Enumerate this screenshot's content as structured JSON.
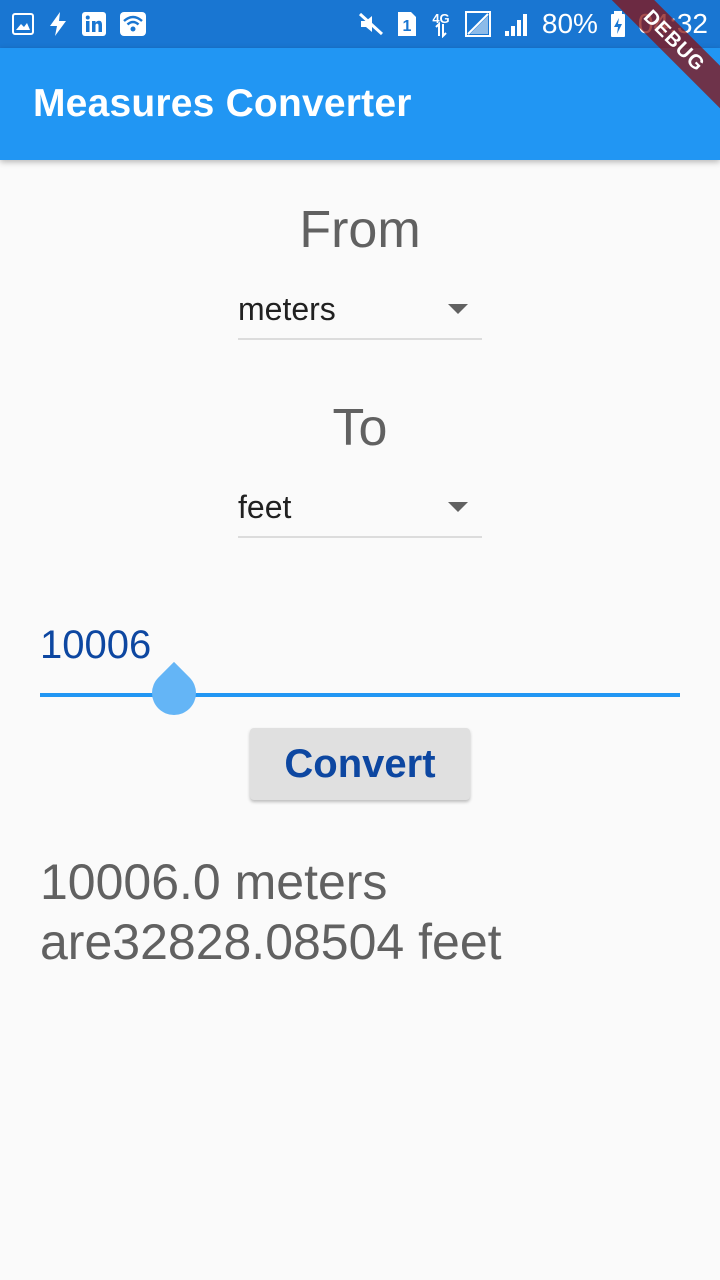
{
  "status_bar": {
    "left_icons": [
      "gallery-icon",
      "flash-icon",
      "linkedin-icon",
      "wifi-icon"
    ],
    "right_icons": [
      "mute-icon",
      "sim-1-icon",
      "4g-icon",
      "no-signal-icon",
      "signal-icon",
      "battery-icon"
    ],
    "sim_label": "1",
    "network_label": "4G",
    "battery": "80%",
    "time": "04:32"
  },
  "app_bar": {
    "title": "Measures Converter"
  },
  "debug_banner": "DEBUG",
  "from": {
    "label": "From",
    "selected": "meters"
  },
  "to": {
    "label": "To",
    "selected": "feet"
  },
  "input": {
    "value": "10006"
  },
  "convert_button": {
    "label": "Convert"
  },
  "result": {
    "line1": "10006.0 meters",
    "line2": "are32828.08504 feet"
  },
  "colors": {
    "status_bar": "#1976d2",
    "app_bar": "#2196f3",
    "accent": "#2196f3",
    "button_text": "#0d47a1",
    "secondary_text": "#616161"
  }
}
